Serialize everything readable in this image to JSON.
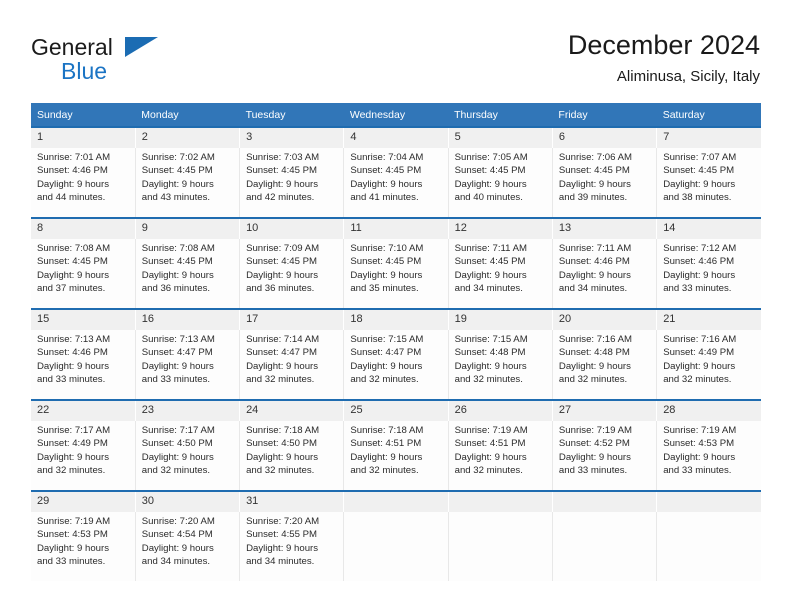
{
  "brand": {
    "name_part1": "General",
    "name_part2": "Blue",
    "triangle_color": "#1b6cb3",
    "blue_color": "#1b74c4"
  },
  "header": {
    "title": "December 2024",
    "subtitle": "Aliminusa, Sicily, Italy"
  },
  "theme": {
    "header_bg": "#3176b8",
    "separator": "#1f6cb0",
    "daynum_bg": "#f0f0f0"
  },
  "weekday_headers": [
    "Sunday",
    "Monday",
    "Tuesday",
    "Wednesday",
    "Thursday",
    "Friday",
    "Saturday"
  ],
  "weeks": [
    {
      "days": [
        {
          "num": "1",
          "sunrise": "Sunrise: 7:01 AM",
          "sunset": "Sunset: 4:46 PM",
          "daylight1": "Daylight: 9 hours",
          "daylight2": "and 44 minutes."
        },
        {
          "num": "2",
          "sunrise": "Sunrise: 7:02 AM",
          "sunset": "Sunset: 4:45 PM",
          "daylight1": "Daylight: 9 hours",
          "daylight2": "and 43 minutes."
        },
        {
          "num": "3",
          "sunrise": "Sunrise: 7:03 AM",
          "sunset": "Sunset: 4:45 PM",
          "daylight1": "Daylight: 9 hours",
          "daylight2": "and 42 minutes."
        },
        {
          "num": "4",
          "sunrise": "Sunrise: 7:04 AM",
          "sunset": "Sunset: 4:45 PM",
          "daylight1": "Daylight: 9 hours",
          "daylight2": "and 41 minutes."
        },
        {
          "num": "5",
          "sunrise": "Sunrise: 7:05 AM",
          "sunset": "Sunset: 4:45 PM",
          "daylight1": "Daylight: 9 hours",
          "daylight2": "and 40 minutes."
        },
        {
          "num": "6",
          "sunrise": "Sunrise: 7:06 AM",
          "sunset": "Sunset: 4:45 PM",
          "daylight1": "Daylight: 9 hours",
          "daylight2": "and 39 minutes."
        },
        {
          "num": "7",
          "sunrise": "Sunrise: 7:07 AM",
          "sunset": "Sunset: 4:45 PM",
          "daylight1": "Daylight: 9 hours",
          "daylight2": "and 38 minutes."
        }
      ]
    },
    {
      "days": [
        {
          "num": "8",
          "sunrise": "Sunrise: 7:08 AM",
          "sunset": "Sunset: 4:45 PM",
          "daylight1": "Daylight: 9 hours",
          "daylight2": "and 37 minutes."
        },
        {
          "num": "9",
          "sunrise": "Sunrise: 7:08 AM",
          "sunset": "Sunset: 4:45 PM",
          "daylight1": "Daylight: 9 hours",
          "daylight2": "and 36 minutes."
        },
        {
          "num": "10",
          "sunrise": "Sunrise: 7:09 AM",
          "sunset": "Sunset: 4:45 PM",
          "daylight1": "Daylight: 9 hours",
          "daylight2": "and 36 minutes."
        },
        {
          "num": "11",
          "sunrise": "Sunrise: 7:10 AM",
          "sunset": "Sunset: 4:45 PM",
          "daylight1": "Daylight: 9 hours",
          "daylight2": "and 35 minutes."
        },
        {
          "num": "12",
          "sunrise": "Sunrise: 7:11 AM",
          "sunset": "Sunset: 4:45 PM",
          "daylight1": "Daylight: 9 hours",
          "daylight2": "and 34 minutes."
        },
        {
          "num": "13",
          "sunrise": "Sunrise: 7:11 AM",
          "sunset": "Sunset: 4:46 PM",
          "daylight1": "Daylight: 9 hours",
          "daylight2": "and 34 minutes."
        },
        {
          "num": "14",
          "sunrise": "Sunrise: 7:12 AM",
          "sunset": "Sunset: 4:46 PM",
          "daylight1": "Daylight: 9 hours",
          "daylight2": "and 33 minutes."
        }
      ]
    },
    {
      "days": [
        {
          "num": "15",
          "sunrise": "Sunrise: 7:13 AM",
          "sunset": "Sunset: 4:46 PM",
          "daylight1": "Daylight: 9 hours",
          "daylight2": "and 33 minutes."
        },
        {
          "num": "16",
          "sunrise": "Sunrise: 7:13 AM",
          "sunset": "Sunset: 4:47 PM",
          "daylight1": "Daylight: 9 hours",
          "daylight2": "and 33 minutes."
        },
        {
          "num": "17",
          "sunrise": "Sunrise: 7:14 AM",
          "sunset": "Sunset: 4:47 PM",
          "daylight1": "Daylight: 9 hours",
          "daylight2": "and 32 minutes."
        },
        {
          "num": "18",
          "sunrise": "Sunrise: 7:15 AM",
          "sunset": "Sunset: 4:47 PM",
          "daylight1": "Daylight: 9 hours",
          "daylight2": "and 32 minutes."
        },
        {
          "num": "19",
          "sunrise": "Sunrise: 7:15 AM",
          "sunset": "Sunset: 4:48 PM",
          "daylight1": "Daylight: 9 hours",
          "daylight2": "and 32 minutes."
        },
        {
          "num": "20",
          "sunrise": "Sunrise: 7:16 AM",
          "sunset": "Sunset: 4:48 PM",
          "daylight1": "Daylight: 9 hours",
          "daylight2": "and 32 minutes."
        },
        {
          "num": "21",
          "sunrise": "Sunrise: 7:16 AM",
          "sunset": "Sunset: 4:49 PM",
          "daylight1": "Daylight: 9 hours",
          "daylight2": "and 32 minutes."
        }
      ]
    },
    {
      "days": [
        {
          "num": "22",
          "sunrise": "Sunrise: 7:17 AM",
          "sunset": "Sunset: 4:49 PM",
          "daylight1": "Daylight: 9 hours",
          "daylight2": "and 32 minutes."
        },
        {
          "num": "23",
          "sunrise": "Sunrise: 7:17 AM",
          "sunset": "Sunset: 4:50 PM",
          "daylight1": "Daylight: 9 hours",
          "daylight2": "and 32 minutes."
        },
        {
          "num": "24",
          "sunrise": "Sunrise: 7:18 AM",
          "sunset": "Sunset: 4:50 PM",
          "daylight1": "Daylight: 9 hours",
          "daylight2": "and 32 minutes."
        },
        {
          "num": "25",
          "sunrise": "Sunrise: 7:18 AM",
          "sunset": "Sunset: 4:51 PM",
          "daylight1": "Daylight: 9 hours",
          "daylight2": "and 32 minutes."
        },
        {
          "num": "26",
          "sunrise": "Sunrise: 7:19 AM",
          "sunset": "Sunset: 4:51 PM",
          "daylight1": "Daylight: 9 hours",
          "daylight2": "and 32 minutes."
        },
        {
          "num": "27",
          "sunrise": "Sunrise: 7:19 AM",
          "sunset": "Sunset: 4:52 PM",
          "daylight1": "Daylight: 9 hours",
          "daylight2": "and 33 minutes."
        },
        {
          "num": "28",
          "sunrise": "Sunrise: 7:19 AM",
          "sunset": "Sunset: 4:53 PM",
          "daylight1": "Daylight: 9 hours",
          "daylight2": "and 33 minutes."
        }
      ]
    },
    {
      "days": [
        {
          "num": "29",
          "sunrise": "Sunrise: 7:19 AM",
          "sunset": "Sunset: 4:53 PM",
          "daylight1": "Daylight: 9 hours",
          "daylight2": "and 33 minutes."
        },
        {
          "num": "30",
          "sunrise": "Sunrise: 7:20 AM",
          "sunset": "Sunset: 4:54 PM",
          "daylight1": "Daylight: 9 hours",
          "daylight2": "and 34 minutes."
        },
        {
          "num": "31",
          "sunrise": "Sunrise: 7:20 AM",
          "sunset": "Sunset: 4:55 PM",
          "daylight1": "Daylight: 9 hours",
          "daylight2": "and 34 minutes."
        },
        {
          "num": "",
          "sunrise": "",
          "sunset": "",
          "daylight1": "",
          "daylight2": ""
        },
        {
          "num": "",
          "sunrise": "",
          "sunset": "",
          "daylight1": "",
          "daylight2": ""
        },
        {
          "num": "",
          "sunrise": "",
          "sunset": "",
          "daylight1": "",
          "daylight2": ""
        },
        {
          "num": "",
          "sunrise": "",
          "sunset": "",
          "daylight1": "",
          "daylight2": ""
        }
      ]
    }
  ]
}
